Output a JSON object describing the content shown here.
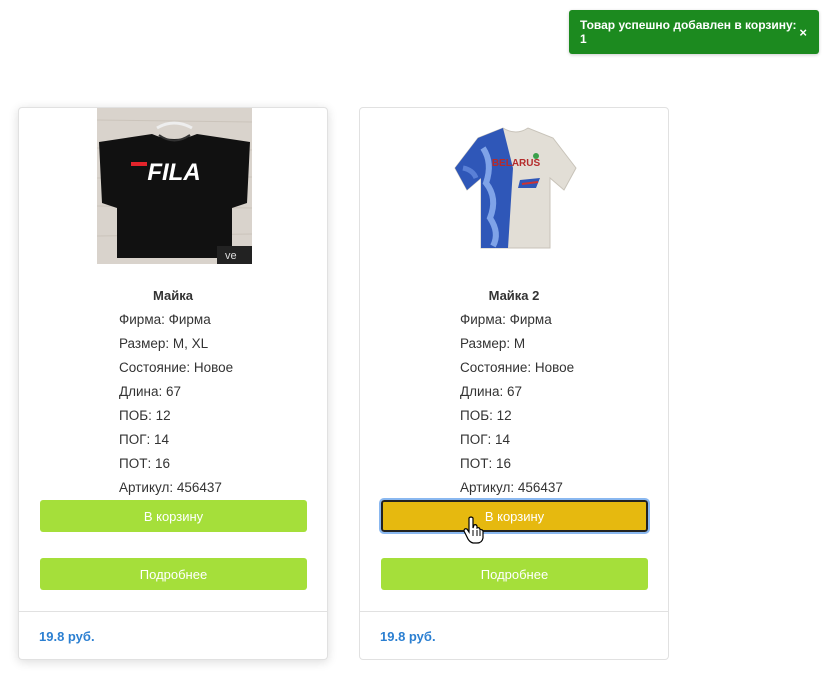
{
  "toast": {
    "message": "Товар успешно добавлен в корзину: 1",
    "close_label": "×"
  },
  "products": [
    {
      "image_brand_text": "FILA",
      "image_watermark": "ve",
      "name": "Майка",
      "attributes": [
        "Фирма: Фирма",
        "Размер: M, XL",
        "Состояние: Новое",
        "Длина: 67",
        "ПОБ: 12",
        "ПОГ: 14",
        "ПОТ: 16",
        "Артикул: 456437"
      ],
      "cart_label": "В корзину",
      "details_label": "Подробнее",
      "price": "19.8 руб."
    },
    {
      "image_brand_text": "BELARUS",
      "name": "Майка 2",
      "attributes": [
        "Фирма: Фирма",
        "Размер: M",
        "Состояние: Новое",
        "Длина: 67",
        "ПОБ: 12",
        "ПОГ: 14",
        "ПОТ: 16",
        "Артикул: 456437"
      ],
      "cart_label": "В корзину",
      "details_label": "Подробнее",
      "price": "19.8 руб."
    }
  ],
  "colors": {
    "toast_bg": "#1c8a1f",
    "button_green": "#a5df3a",
    "button_hover": "#e6b90f",
    "price_blue": "#2b7fd1"
  }
}
